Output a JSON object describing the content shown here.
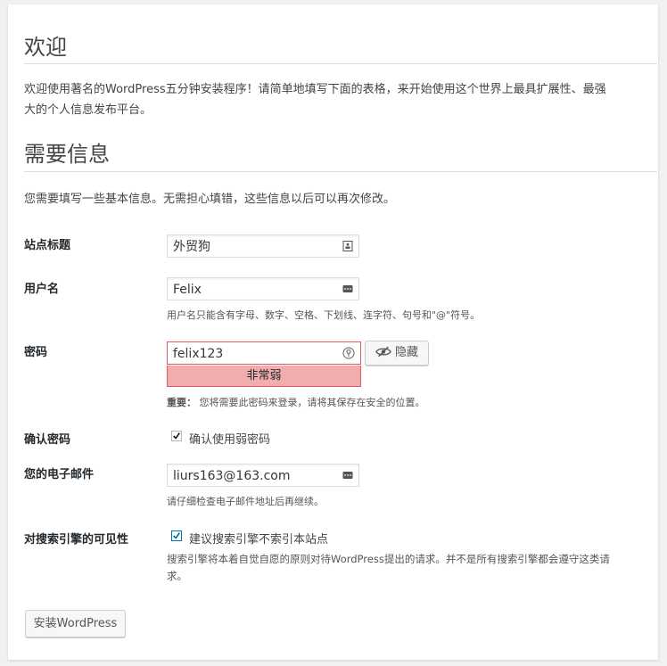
{
  "welcome": {
    "title": "欢迎",
    "text_line1": "欢迎使用著名的WordPress五分钟安装程序！请简单地填写下面的表格，来开始使用这个世界上最具扩展性、最强",
    "text_line2": "大的个人信息发布平台。"
  },
  "info": {
    "title": "需要信息",
    "text": "您需要填写一些基本信息。无需担心填错，这些信息以后可以再次修改。"
  },
  "form": {
    "site_title": {
      "label": "站点标题",
      "value": "外贸狗"
    },
    "username": {
      "label": "用户名",
      "value": "Felix",
      "hint": "用户名只能含有字母、数字、空格、下划线、连字符、句号和\"@\"符号。"
    },
    "password": {
      "label": "密码",
      "value": "felix123",
      "strength": "非常弱",
      "hide_label": "隐藏",
      "hint_bold": "重要：",
      "hint": "您将需要此密码来登录，请将其保存在安全的位置。"
    },
    "confirm_password": {
      "label": "确认密码",
      "checkbox_label": "确认使用弱密码"
    },
    "email": {
      "label": "您的电子邮件",
      "value": "liurs163@163.com",
      "hint": "请仔细检查电子邮件地址后再继续。"
    },
    "visibility": {
      "label": "对搜索引擎的可见性",
      "checkbox_label": "建议搜索引擎不索引本站点",
      "hint_line1": "搜索引擎将本着自觉自愿的原则对待WordPress提出的请求。并不是所有搜索引擎都会遵守这类请",
      "hint_line2": "求。"
    },
    "install_button": "安装WordPress"
  },
  "colors": {
    "accent": "#0073aa",
    "error_border": "#e35b5b",
    "weak_bg": "#f1adad"
  }
}
